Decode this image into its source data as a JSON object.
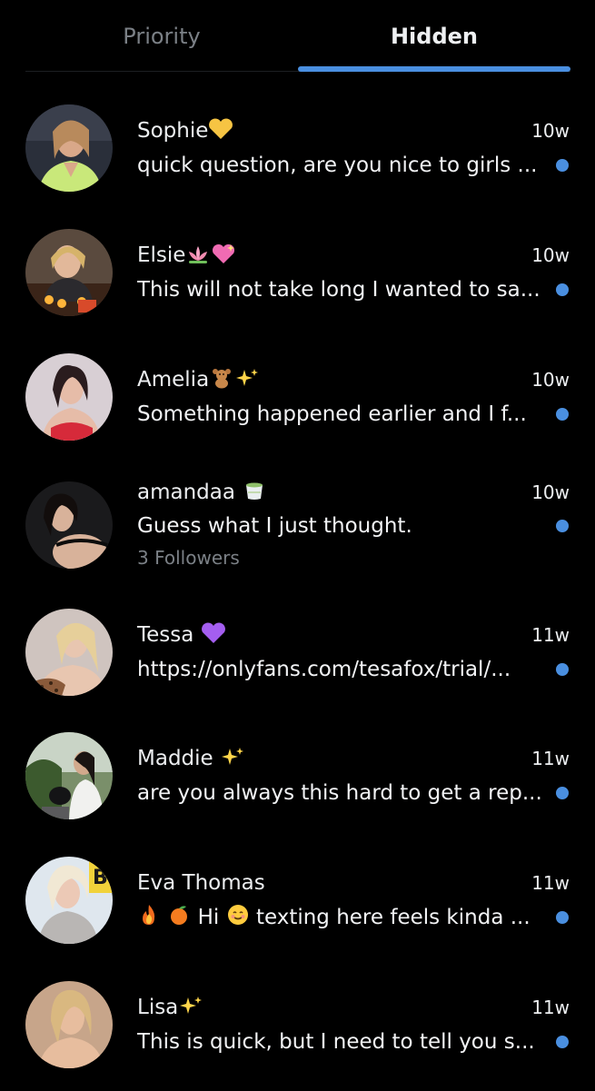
{
  "accent_color": "#4a8fe0",
  "tabs": [
    {
      "label": "Priority",
      "active": false
    },
    {
      "label": "Hidden",
      "active": true
    }
  ],
  "conversations": [
    {
      "name": "Sophie",
      "name_emojis": [
        "yellow-heart"
      ],
      "time": "10w",
      "preview": "quick question, are you nice to girls ...",
      "unread": true
    },
    {
      "name": "Elsie",
      "name_emojis": [
        "lotus",
        "sparkling-heart"
      ],
      "time": "10w",
      "preview": "This will not take long I wanted to sa...",
      "unread": true
    },
    {
      "name": "Amelia",
      "name_emojis": [
        "teddy-bear",
        "sparkles"
      ],
      "time": "10w",
      "preview": "Something happened earlier and I f...",
      "unread": true
    },
    {
      "name": "amandaa",
      "name_emojis": [
        "matcha-cup"
      ],
      "time": "10w",
      "preview": "Guess what I just thought.",
      "subtext": "3 Followers",
      "unread": true
    },
    {
      "name": "Tessa",
      "name_emojis": [
        "purple-heart"
      ],
      "time": "11w",
      "preview": "https://onlyfans.com/tesafox/trial/...",
      "unread": true
    },
    {
      "name": "Maddie",
      "name_emojis": [
        "sparkles"
      ],
      "time": "11w",
      "preview": "are you always this hard to get a rep...",
      "unread": true
    },
    {
      "name": "Eva Thomas",
      "name_emojis": [],
      "time": "11w",
      "preview_emojis": [
        "fire",
        "tangerine"
      ],
      "preview": "Hi",
      "preview_emoji_mid": "smiling-face",
      "preview_tail": "texting here feels kinda ...",
      "unread": true
    },
    {
      "name": "Lisa",
      "name_emojis": [
        "sparkles"
      ],
      "time": "11w",
      "preview": "This is quick, but I need to tell you s...",
      "unread": true
    }
  ]
}
